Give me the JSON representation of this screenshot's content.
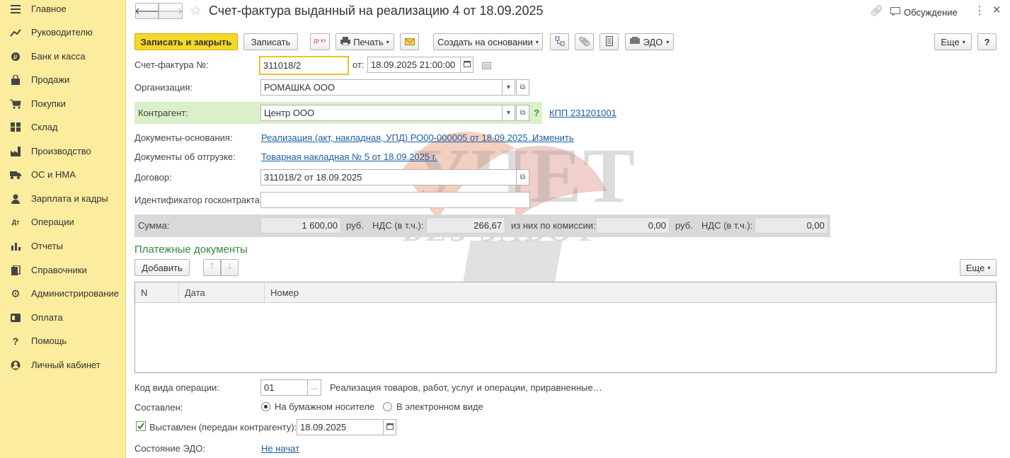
{
  "sidebar": {
    "items": [
      {
        "label": "Главное",
        "icon": "menu-icon"
      },
      {
        "label": "Руководителю",
        "icon": "chart-line-icon"
      },
      {
        "label": "Банк и касса",
        "icon": "coin-icon"
      },
      {
        "label": "Продажи",
        "icon": "bag-icon"
      },
      {
        "label": "Покупки",
        "icon": "cart-icon"
      },
      {
        "label": "Склад",
        "icon": "warehouse-icon"
      },
      {
        "label": "Производство",
        "icon": "factory-icon"
      },
      {
        "label": "ОС и НМА",
        "icon": "truck-icon"
      },
      {
        "label": "Зарплата и кадры",
        "icon": "person-icon"
      },
      {
        "label": "Операции",
        "icon": "dt-kt-icon"
      },
      {
        "label": "Отчеты",
        "icon": "bar-chart-icon"
      },
      {
        "label": "Справочники",
        "icon": "books-icon"
      },
      {
        "label": "Администрирование",
        "icon": "gear-icon"
      },
      {
        "label": "Оплата",
        "icon": "payment-icon"
      },
      {
        "label": "Помощь",
        "icon": "question-icon"
      },
      {
        "label": "Личный кабинет",
        "icon": "account-icon"
      }
    ]
  },
  "header": {
    "title": "Счет-фактура выданный на реализацию 4 от 18.09.2025",
    "discussion": "Обсуждение"
  },
  "toolbar": {
    "save_close": "Записать и закрыть",
    "save": "Записать",
    "dtkt": "Дт Кт",
    "print": "Печать",
    "create_based": "Создать на основании",
    "edo": "ЭДО",
    "more": "Еще",
    "help": "?"
  },
  "form": {
    "invoice_label": "Счет-фактура №:",
    "invoice_number": "311018/2",
    "from_label": "от:",
    "date": "18.09.2025 21:00:00",
    "org_label": "Организация:",
    "org": "РОМАШКА ООО",
    "contractor_label": "Контрагент:",
    "contractor": "Центр ООО",
    "contractor_help": "?",
    "kpp": "КПП 231201001",
    "base_docs_label": "Документы-основания:",
    "base_docs": "Реализация (акт, накладная, УПД) РО00-000005 от 18.09.2025…",
    "change": "Изменить",
    "ship_docs_label": "Документы об отгрузке:",
    "ship_docs": "Товарная накладная № 5 от 18.09.2025 г.",
    "contract_label": "Договор:",
    "contract": "311018/2 от 18.09.2025",
    "gov_label": "Идентификатор госконтракта:",
    "gov": ""
  },
  "sums": {
    "sum_label": "Сумма:",
    "sum": "1 600,00",
    "cur1": "руб.",
    "vat_label": "НДС (в т.ч.):",
    "vat": "266,67",
    "commission_label": "из них по комиссии:",
    "commission": "0,00",
    "cur2": "руб.",
    "vat2_label": "НДС (в т.ч.):",
    "vat2": "0,00"
  },
  "payments": {
    "title": "Платежные документы",
    "add": "Добавить",
    "more": "Еще",
    "columns": [
      "N",
      "Дата",
      "Номер"
    ],
    "rows": []
  },
  "bottom": {
    "op_code_label": "Код вида операции:",
    "op_code": "01",
    "op_desc": "Реализация товаров, работ, услуг и операции, приравненные…",
    "composed_label": "Составлен:",
    "paper": "На бумажном носителе",
    "electronic": "В электронном виде",
    "issued_label": "Выставлен (передан контрагенту):",
    "issued_date": "18.09.2025",
    "edo_state_label": "Состояние ЭДО:",
    "edo_state": "Не начат"
  },
  "watermark": {
    "line1": "УЧЕТ",
    "line2": "БЕЗ ЗАБОТ"
  },
  "colors": {
    "sidebar": "#fbec9e",
    "primary_button": "#f5d829",
    "link": "#1b5ea8",
    "section_title": "#2e8b3a",
    "contractor_band": "#d9f0c8"
  }
}
